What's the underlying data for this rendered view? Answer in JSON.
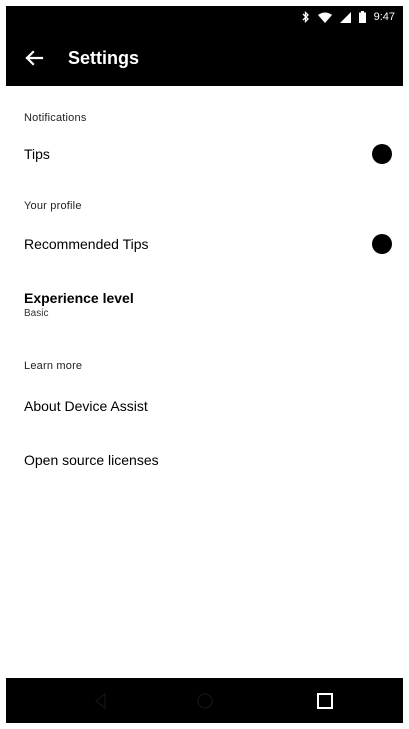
{
  "status_bar": {
    "time": "9:47",
    "icons": [
      "bluetooth-icon",
      "wifi-icon",
      "signal-icon",
      "battery-icon"
    ]
  },
  "app_bar": {
    "title": "Settings",
    "back_icon": "arrow-left-icon"
  },
  "sections": {
    "notifications": {
      "header": "Notifications",
      "tips_label": "Tips",
      "tips_enabled": true
    },
    "profile": {
      "header": "Your profile",
      "recommended_tips_label": "Recommended Tips",
      "recommended_tips_enabled": true,
      "experience_label": "Experience level",
      "experience_value": "Basic"
    },
    "learn_more": {
      "header": "Learn more",
      "about_label": "About Device Assist",
      "licenses_label": "Open source licenses"
    }
  },
  "nav_bar": {
    "back_icon": "nav-back-icon",
    "home_icon": "nav-home-icon",
    "recents_icon": "nav-recents-icon"
  },
  "colors": {
    "bar": "#000000",
    "background": "#ffffff",
    "text": "#000000"
  }
}
